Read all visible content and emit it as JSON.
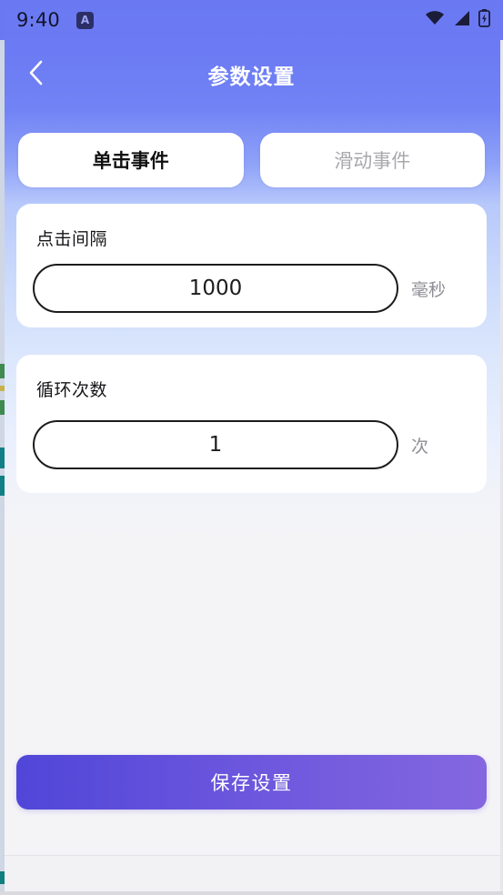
{
  "status_bar": {
    "time": "9:40",
    "app_badge_letter": "A",
    "icons": [
      "wifi-icon",
      "cellular-signal-icon",
      "battery-charging-icon"
    ]
  },
  "header": {
    "back_icon": "chevron-left-icon",
    "title": "参数设置"
  },
  "tabs": [
    {
      "label": "单击事件",
      "active": true
    },
    {
      "label": "滑动事件",
      "active": false
    }
  ],
  "fields": [
    {
      "label": "点击间隔",
      "value": "1000",
      "placeholder": "1000",
      "unit": "毫秒"
    },
    {
      "label": "循环次数",
      "value": "1",
      "placeholder": "1",
      "unit": "次"
    }
  ],
  "save_button": {
    "label": "保存设置"
  },
  "colors": {
    "header_gradient_top": "#6a79f2",
    "background_bottom": "#f4f4f7",
    "card_background": "#ffffff",
    "tab_active_text": "#111111",
    "tab_inactive_text": "#a8a8ae",
    "input_border": "#1c1c1c",
    "unit_text": "#8d8d95",
    "save_gradient_start": "#5046d8",
    "save_gradient_end": "#8467e0"
  }
}
